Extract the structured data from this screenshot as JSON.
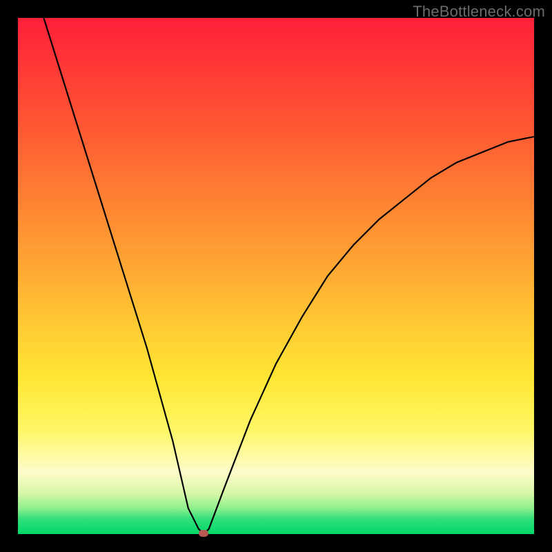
{
  "watermark": "TheBottleneck.com",
  "chart_data": {
    "type": "line",
    "title": "",
    "xlabel": "",
    "ylabel": "",
    "xlim": [
      0,
      100
    ],
    "ylim": [
      0,
      100
    ],
    "grid": false,
    "legend": false,
    "series": [
      {
        "name": "bottleneck-curve",
        "x": [
          5,
          10,
          15,
          20,
          25,
          30,
          33,
          35,
          36,
          37,
          40,
          45,
          50,
          55,
          60,
          65,
          70,
          75,
          80,
          85,
          90,
          95,
          100
        ],
        "y": [
          100,
          84,
          68,
          52,
          36,
          18,
          5,
          1,
          0,
          1,
          9,
          22,
          33,
          42,
          50,
          56,
          61,
          65,
          69,
          72,
          74,
          76,
          77
        ]
      }
    ],
    "annotations": [
      {
        "name": "min-marker",
        "x": 36,
        "y": 0
      }
    ],
    "background_gradient": {
      "direction": "vertical",
      "stops": [
        {
          "pos": 0.0,
          "color": "#ff1f3a"
        },
        {
          "pos": 0.35,
          "color": "#ff8133"
        },
        {
          "pos": 0.7,
          "color": "#ffe733"
        },
        {
          "pos": 0.9,
          "color": "#fdfccb"
        },
        {
          "pos": 1.0,
          "color": "#00d86a"
        }
      ]
    }
  },
  "plot_geometry": {
    "outer_w": 800,
    "outer_h": 800,
    "inner_left": 26,
    "inner_top": 26,
    "inner_w": 748,
    "inner_h": 748
  }
}
